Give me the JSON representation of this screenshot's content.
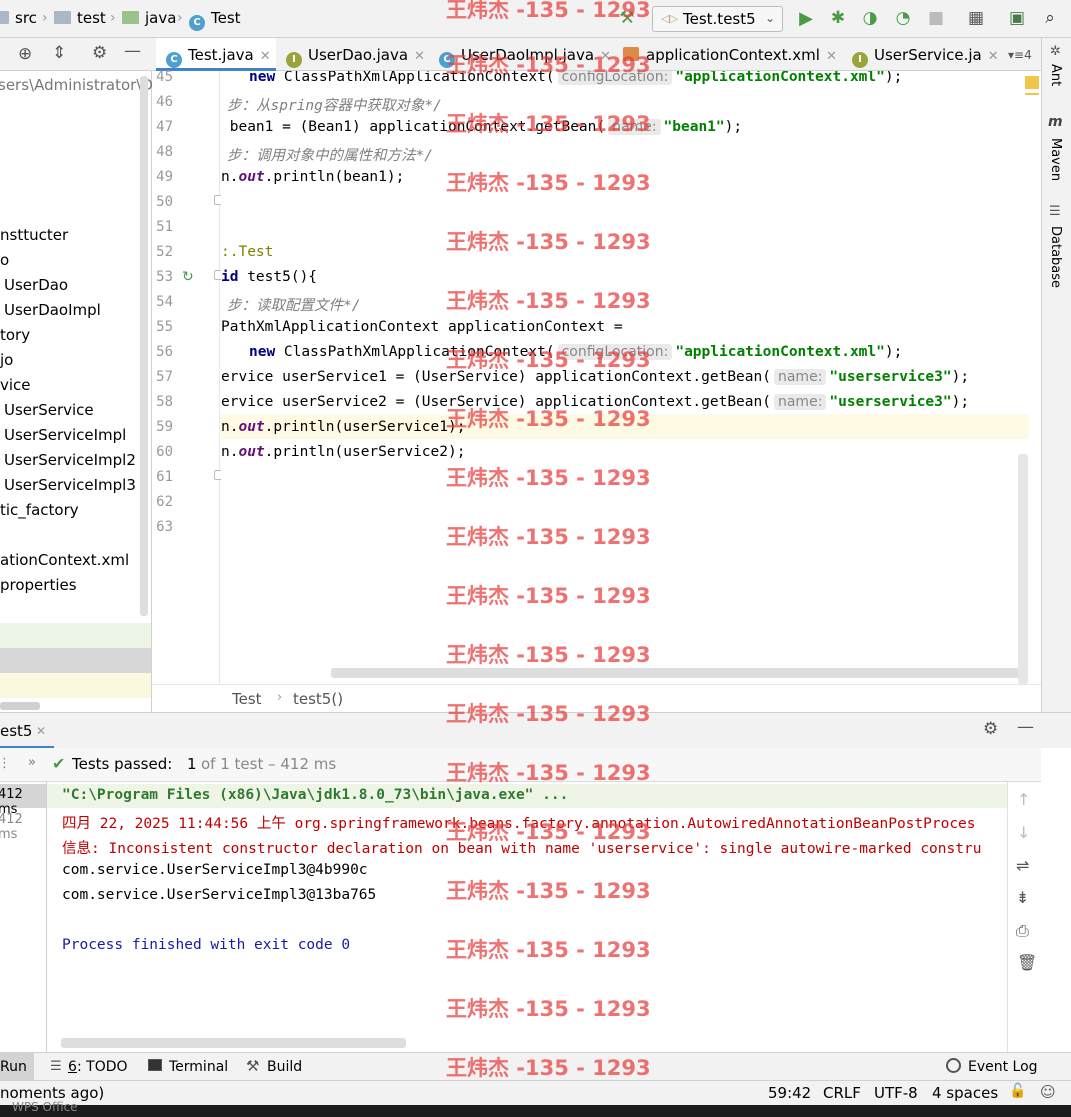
{
  "navbar": {
    "crumbs": [
      "src",
      "test",
      "java",
      "Test"
    ],
    "run_config": "Test.test5"
  },
  "project_tree": {
    "path_fragment": "sers\\Administrator\\D",
    "items": [
      "nsttucter",
      "o",
      "UserDao",
      "UserDaoImpl",
      "tory",
      "jo",
      "vice",
      "UserService",
      "UserServiceImpl",
      "UserServiceImpl2",
      "UserServiceImpl3",
      "tic_factory",
      "ationContext.xml",
      "properties"
    ]
  },
  "tabs": [
    {
      "label": "Test.java",
      "active": true
    },
    {
      "label": "UserDao.java",
      "active": false
    },
    {
      "label": "UserDaoImpl.java",
      "active": false
    },
    {
      "label": "applicationContext.xml",
      "active": false
    },
    {
      "label": "UserService.ja",
      "active": false
    }
  ],
  "tab_overflow": "4",
  "editor": {
    "line_numbers": [
      "45",
      "46",
      "47",
      "48",
      "49",
      "50",
      "51",
      "52",
      "53",
      "54",
      "55",
      "56",
      "57",
      "58",
      "59",
      "60",
      "61",
      "62",
      "63"
    ],
    "current_line": "59",
    "code": {
      "l45_kw": "new",
      "l45_text": " ClassPathXmlApplicationContext(",
      "l45_hint": "configLocation:",
      "l45_str": "\"applicationContext.xml\"",
      "l45_end": ");",
      "l46_comment": "步：从spring容器中获取对象*/",
      "l47_text": " bean1 = (Bean1) applicationContext.getBean(",
      "l47_hint": "name:",
      "l47_str": "\"bean1\"",
      "l47_end": ");",
      "l48_comment": "步：调用对象中的属性和方法*/",
      "l49_pre": "n.",
      "l49_field": "out",
      "l49_text": ".println(bean1);",
      "l52_annotation": ":.Test",
      "l53_kw": "id",
      "l53_text": " test5(){",
      "l54_comment": "步：读取配置文件*/",
      "l55_text": "PathXmlApplicationContext applicationContext =",
      "l56_kw": "new",
      "l56_text": " ClassPathXmlApplicationContext(",
      "l56_hint": "configLocation:",
      "l56_str": "\"applicationContext.xml\"",
      "l56_end": ");",
      "l57_text": "ervice userService1 = (UserService) applicationContext.getBean(",
      "l57_hint": "name:",
      "l57_str": "\"userservice3\"",
      "l57_end": ");",
      "l58_text": "ervice userService2 = (UserService) applicationContext.getBean(",
      "l58_hint": "name:",
      "l58_str": "\"userservice3\"",
      "l58_end": ");",
      "l59_pre": "n.",
      "l59_field": "out",
      "l59_text": ".println(userService1);",
      "l60_pre": "n.",
      "l60_field": "out",
      "l60_text": ".println(userService2);"
    }
  },
  "right_strip": [
    "Ant",
    "Maven",
    "Database"
  ],
  "code_breadcrumb": [
    "Test",
    "test5()"
  ],
  "run_panel": {
    "tab_label": "est5",
    "tests_passed_label": "Tests passed:",
    "tests_passed_count": "1",
    "tests_passed_detail": "of 1 test – 412 ms",
    "durations": [
      "412 ms",
      "412 ms"
    ],
    "console": [
      "\"C:\\Program Files (x86)\\Java\\jdk1.8.0_73\\bin\\java.exe\" ...",
      "四月 22, 2025 11:44:56 上午 org.springframework.beans.factory.annotation.AutowiredAnnotationBeanPostProces",
      "信息: Inconsistent constructor declaration on bean with name 'userservice': single autowire-marked constru",
      "com.service.UserServiceImpl3@4b990c",
      "com.service.UserServiceImpl3@13ba765",
      "Process finished with exit code 0"
    ]
  },
  "tool_windows": {
    "run": "Run",
    "todo_num": "6",
    "todo": ": TODO",
    "terminal": "Terminal",
    "build": "Build",
    "event_log": "Event Log"
  },
  "status_bar": {
    "message": "noments ago)",
    "position": "59:42",
    "line_sep": "CRLF",
    "encoding": "UTF-8",
    "indent": "4 spaces"
  },
  "taskbar_text": "WPS Office",
  "watermark": "王炜杰 -135 - 1293",
  "colors": {
    "accent": "#4083c9",
    "string": "#008000",
    "keyword": "#000080",
    "comment": "#808080",
    "watermark": "#e63c3c",
    "current_line": "#fffae3"
  }
}
